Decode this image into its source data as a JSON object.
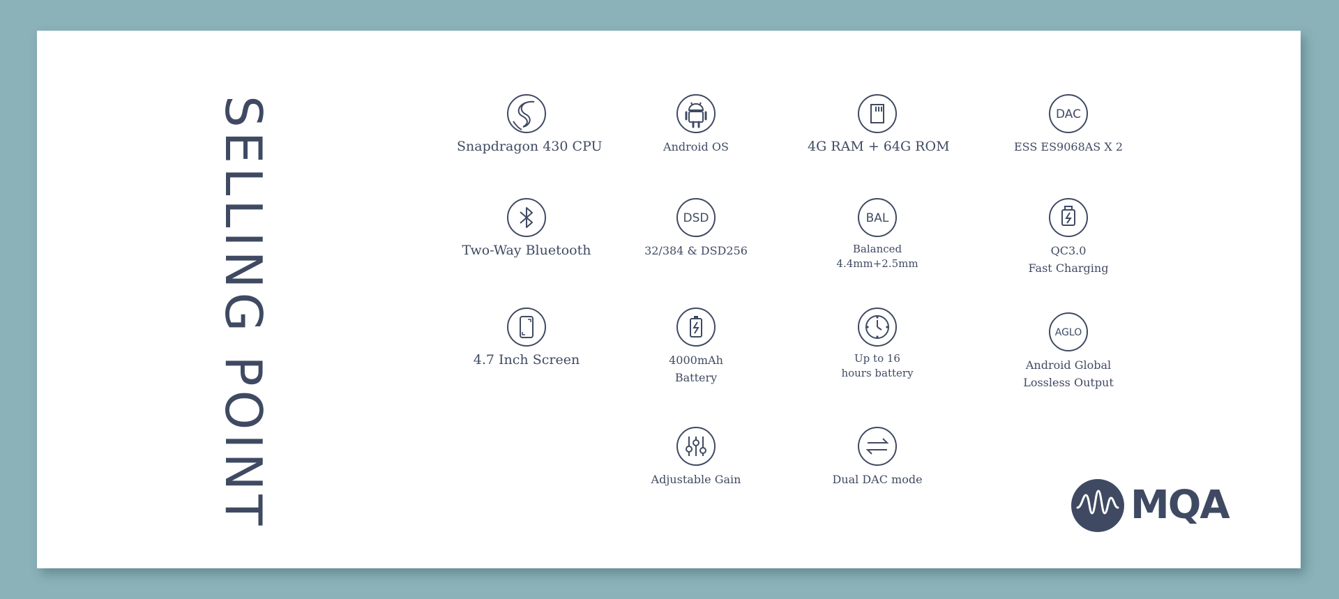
{
  "title": "SELLING POINT",
  "brand": {
    "logo_text": "MQA",
    "color": "#3f4a62"
  },
  "colors": {
    "background": "#8ab2b8",
    "card": "#ffffff",
    "ink": "#3f4a62"
  },
  "features": [
    {
      "icon": "snapdragon-icon",
      "label": "Snapdragon  430 CPU"
    },
    {
      "icon": "android-icon",
      "label": "Android OS"
    },
    {
      "icon": "sd-card-icon",
      "label": "4G RAM + 64G ROM"
    },
    {
      "icon": "dac-icon",
      "icon_text": "DAC",
      "label": "ESS ES9068AS X 2"
    },
    {
      "icon": "bluetooth-icon",
      "label": "Two-Way  Bluetooth"
    },
    {
      "icon": "dsd-icon",
      "icon_text": "DSD",
      "label": "32/384 & DSD256"
    },
    {
      "icon": "bal-icon",
      "icon_text": "BAL",
      "label_line1": "Balanced",
      "label_line2": "4.4mm+2.5mm"
    },
    {
      "icon": "fast-charge-icon",
      "label_line1": "QC3.0",
      "label_line2": "Fast Charging"
    },
    {
      "icon": "phone-screen-icon",
      "label": "4.7  Inch Screen"
    },
    {
      "icon": "battery-icon",
      "label_line1": "4000mAh",
      "label_line2": "Battery"
    },
    {
      "icon": "clock-icon",
      "label_line1": "Up to 16",
      "label_line2": "hours battery"
    },
    {
      "icon": "aglo-icon",
      "icon_text": "AGLO",
      "label_line1": "Android Global",
      "label_line2": "Lossless Output"
    },
    {
      "icon": "equalizer-icon",
      "label": "Adjustable Gain"
    },
    {
      "icon": "swap-arrows-icon",
      "label": "Dual DAC mode"
    }
  ]
}
